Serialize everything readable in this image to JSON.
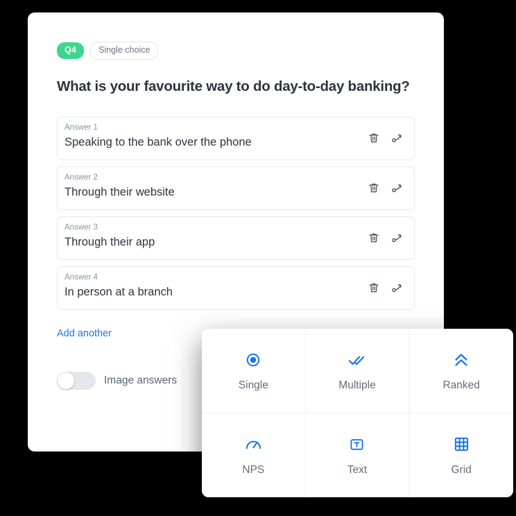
{
  "card": {
    "badge_number": "Q4",
    "badge_type": "Single choice",
    "title": "What is your favourite way to do day-to-day banking?",
    "accent_green": "#3dd68c",
    "accent_blue": "#1a73e8",
    "answers": [
      {
        "label": "Answer 1",
        "value": "Speaking to the bank over the phone",
        "delete_icon": "trash-icon",
        "logic_icon": "branch-logic-icon"
      },
      {
        "label": "Answer 2",
        "value": "Through their website",
        "delete_icon": "trash-icon",
        "logic_icon": "branch-logic-icon"
      },
      {
        "label": "Answer 3",
        "value": "Through their app",
        "delete_icon": "trash-icon",
        "logic_icon": "branch-logic-icon"
      },
      {
        "label": "Answer 4",
        "value": "In person at a branch",
        "delete_icon": "trash-icon",
        "logic_icon": "branch-logic-icon"
      }
    ],
    "add_another_label": "Add another",
    "toggles": [
      {
        "label": "Image answers",
        "state": "off"
      },
      {
        "label": "",
        "state": "off"
      }
    ]
  },
  "type_picker": {
    "options": [
      {
        "label": "Single",
        "icon": "radio-filled-icon"
      },
      {
        "label": "Multiple",
        "icon": "double-check-icon"
      },
      {
        "label": "Ranked",
        "icon": "double-chevron-up-icon"
      },
      {
        "label": "NPS",
        "icon": "gauge-icon"
      },
      {
        "label": "Text",
        "icon": "text-box-icon"
      },
      {
        "label": "Grid",
        "icon": "grid-icon"
      }
    ]
  }
}
